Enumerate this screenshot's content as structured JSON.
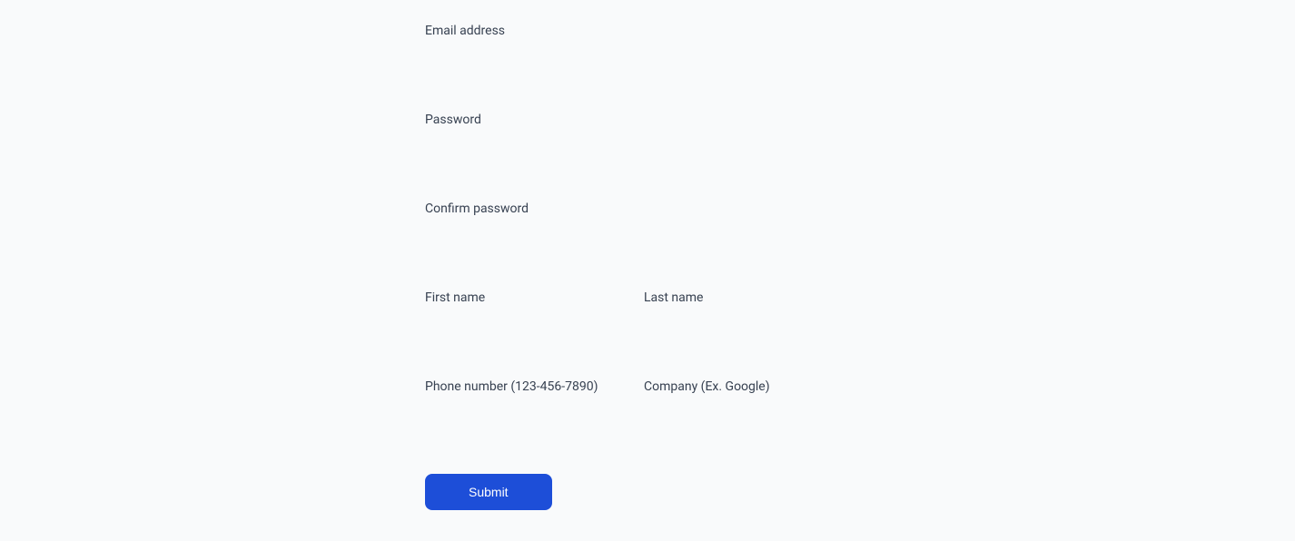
{
  "form": {
    "email": {
      "label": "Email address",
      "value": ""
    },
    "password": {
      "label": "Password",
      "value": ""
    },
    "confirmPassword": {
      "label": "Confirm password",
      "value": ""
    },
    "firstName": {
      "label": "First name",
      "value": ""
    },
    "lastName": {
      "label": "Last name",
      "value": ""
    },
    "phone": {
      "label": "Phone number (123-456-7890)",
      "value": ""
    },
    "company": {
      "label": "Company (Ex. Google)",
      "value": ""
    },
    "submit": {
      "label": "Submit"
    }
  }
}
